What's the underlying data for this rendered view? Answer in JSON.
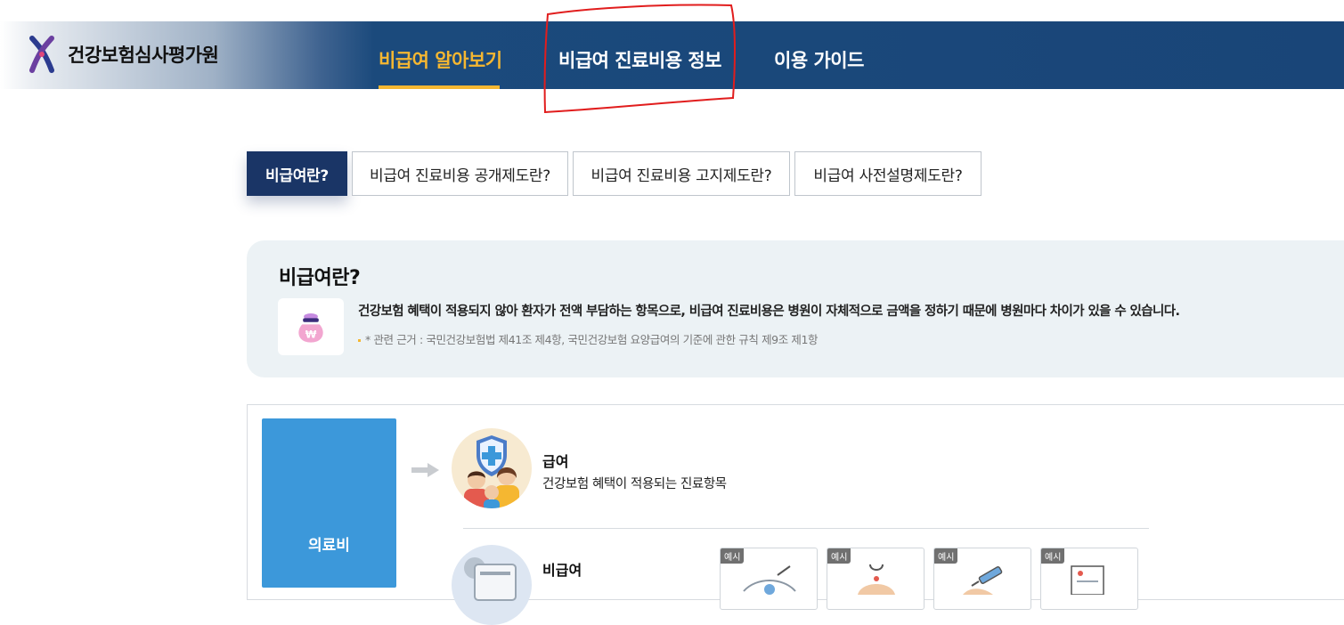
{
  "header": {
    "logo_text": "건강보험심사평가원",
    "nav": [
      {
        "label": "비급여 알아보기",
        "active": true
      },
      {
        "label": "비급여 진료비용 정보",
        "active": false
      },
      {
        "label": "이용 가이드",
        "active": false
      }
    ]
  },
  "tabs": [
    {
      "label": "비급여란?",
      "active": true
    },
    {
      "label": "비급여 진료비용 공개제도란?",
      "active": false
    },
    {
      "label": "비급여 진료비용 고지제도란?",
      "active": false
    },
    {
      "label": "비급여 사전설명제도란?",
      "active": false
    }
  ],
  "info": {
    "title": "비급여란?",
    "icon": "money-bag-icon",
    "description": "건강보험 혜택이 적용되지 않아 환자가 전액 부담하는 항목으로, 비급여 진료비용은 병원이 자체적으로 금액을 정하기 때문에 병원마다 차이가 있을 수 있습니다.",
    "note": "* 관련 근거 : 국민건강보험법 제41조 제4항, 국민건강보험 요양급여의 기준에 관한 규칙 제9조 제1항"
  },
  "diagram": {
    "root_label": "의료비",
    "covered": {
      "title": "급여",
      "description": "건강보험 혜택이 적용되는 진료항목"
    },
    "noncovered": {
      "title": "비급여"
    },
    "example_tag": "예시"
  },
  "colors": {
    "header_bg": "#194578",
    "accent": "#f5b731",
    "tab_active": "#1a3566",
    "root_box": "#3c98da",
    "info_bg": "#ecf2f5"
  }
}
